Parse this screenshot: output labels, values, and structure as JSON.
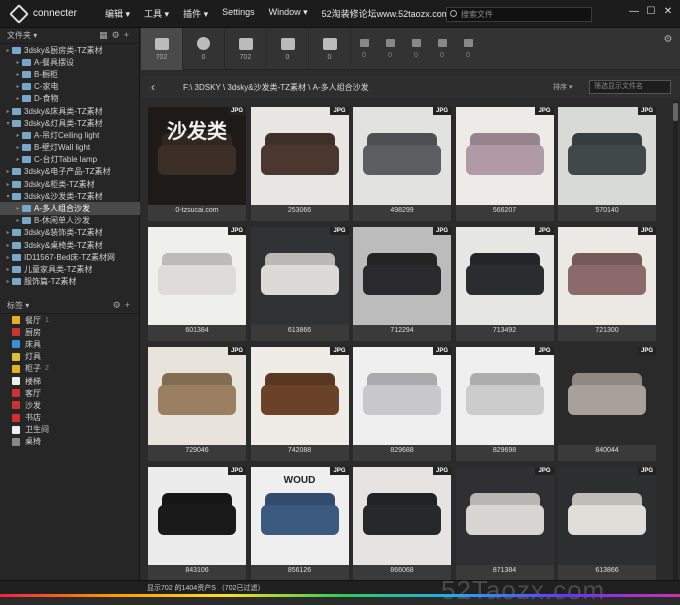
{
  "app": {
    "name": "connecter"
  },
  "menu": [
    "编辑 ▾",
    "工具 ▾",
    "插件 ▾",
    "Settings",
    "Window ▾",
    "52淘装修论坛www.52taozx.com ▾"
  ],
  "search": {
    "placeholder": "搜索文件"
  },
  "left": {
    "folders_title": "文件夹 ▾",
    "tags_title": "标签 ▾",
    "tree": [
      {
        "label": "3dsky&厨房类-TZ素材",
        "level": 0,
        "arrow": "▸",
        "sel": false
      },
      {
        "label": "A-餐具摆设",
        "level": 1,
        "arrow": "▸",
        "sel": false
      },
      {
        "label": "B-橱柜",
        "level": 1,
        "arrow": "▸",
        "sel": false
      },
      {
        "label": "C-家电",
        "level": 1,
        "arrow": "▸",
        "sel": false
      },
      {
        "label": "D-食物",
        "level": 1,
        "arrow": "▸",
        "sel": false
      },
      {
        "label": "3dsky&床具类-TZ素材",
        "level": 0,
        "arrow": "▸",
        "sel": false
      },
      {
        "label": "3dsky&灯具类-TZ素材",
        "level": 0,
        "arrow": "▾",
        "sel": false
      },
      {
        "label": "A-吊灯Ceiling light",
        "level": 1,
        "arrow": "▸",
        "sel": false
      },
      {
        "label": "B-壁灯Wall light",
        "level": 1,
        "arrow": "▸",
        "sel": false
      },
      {
        "label": "C-台灯Table lamp",
        "level": 1,
        "arrow": "▸",
        "sel": false
      },
      {
        "label": "3dsky&电子产品-TZ素材",
        "level": 0,
        "arrow": "▸",
        "sel": false
      },
      {
        "label": "3dsky&柜类-TZ素材",
        "level": 0,
        "arrow": "▸",
        "sel": false
      },
      {
        "label": "3dsky&沙发类-TZ素材",
        "level": 0,
        "arrow": "▾",
        "sel": false
      },
      {
        "label": "A-多人组合沙发",
        "level": 1,
        "arrow": "▸",
        "sel": true
      },
      {
        "label": "B-休闲单人沙发",
        "level": 1,
        "arrow": "▸",
        "sel": false
      },
      {
        "label": "3dsky&装饰类-TZ素材",
        "level": 0,
        "arrow": "▸",
        "sel": false
      },
      {
        "label": "3dsky&桌椅类-TZ素材",
        "level": 0,
        "arrow": "▸",
        "sel": false
      },
      {
        "label": "ID11567-Bed床-TZ素材网",
        "level": 0,
        "arrow": "▸",
        "sel": false
      },
      {
        "label": "儿童家具类-TZ素材",
        "level": 0,
        "arrow": "▸",
        "sel": false
      },
      {
        "label": "服饰篇-TZ素材",
        "level": 0,
        "arrow": "▸",
        "sel": false
      }
    ],
    "tags": [
      {
        "label": "餐厅",
        "count": "1",
        "color": "#e8b020"
      },
      {
        "label": "厨房",
        "count": "",
        "color": "#d03030"
      },
      {
        "label": "床具",
        "count": "",
        "color": "#3a8ed8"
      },
      {
        "label": "灯具",
        "count": "",
        "color": "#d8c030"
      },
      {
        "label": "柜子",
        "count": "2",
        "color": "#e8b020"
      },
      {
        "label": "楼梯",
        "count": "",
        "color": "#eeeeee"
      },
      {
        "label": "客厅",
        "count": "",
        "color": "#d03030"
      },
      {
        "label": "沙发",
        "count": "",
        "color": "#d03030"
      },
      {
        "label": "书店",
        "count": "",
        "color": "#d03030"
      },
      {
        "label": "卫生间",
        "count": "",
        "color": "#eeeeee"
      },
      {
        "label": "桌椅",
        "count": "",
        "color": "#888888"
      }
    ]
  },
  "toolbar": {
    "big": [
      {
        "count": "702"
      },
      {
        "count": "0"
      },
      {
        "count": "702"
      },
      {
        "count": "0"
      },
      {
        "count": "0"
      }
    ],
    "small": [
      "0",
      "0",
      "0",
      "0",
      "0"
    ]
  },
  "path": {
    "text": "F:\\ 3DSKY \\ 3dsky&沙发类-TZ素材 \\ A-多人组合沙发",
    "sort": "排序 ▾",
    "filter_placeholder": "筛选显示文件名"
  },
  "badge": "JPG",
  "items": [
    {
      "name": "0-tzsucai.com",
      "bg": "#1e1a18",
      "c": "#3a2e26",
      "title": "沙发类"
    },
    {
      "name": "253066",
      "bg": "#e8e6e2",
      "c": "#4a3830",
      "title": ""
    },
    {
      "name": "498299",
      "bg": "#e2e2e0",
      "c": "#5a5e60",
      "title": ""
    },
    {
      "name": "566207",
      "bg": "#ecebe8",
      "c": "#b09aa6",
      "title": ""
    },
    {
      "name": "570140",
      "bg": "#d8dad8",
      "c": "#40484a",
      "title": ""
    },
    {
      "name": "601384",
      "bg": "#efefec",
      "c": "#dedcd8",
      "title": ""
    },
    {
      "name": "613866",
      "bg": "#303234",
      "c": "#dcdad6",
      "title": ""
    },
    {
      "name": "712294",
      "bg": "#bcbcbc",
      "c": "#2a2a2c",
      "title": ""
    },
    {
      "name": "713492",
      "bg": "#e6e6e4",
      "c": "#2a2c30",
      "title": ""
    },
    {
      "name": "721300",
      "bg": "#ece8e4",
      "c": "#8a6a6a",
      "title": ""
    },
    {
      "name": "729046",
      "bg": "#e8e4dc",
      "c": "#9a8060",
      "title": ""
    },
    {
      "name": "742088",
      "bg": "#efece8",
      "c": "#6a4228",
      "title": ""
    },
    {
      "name": "829688",
      "bg": "#efefef",
      "c": "#c8c8cc",
      "title": ""
    },
    {
      "name": "829698",
      "bg": "#efefef",
      "c": "#cccccc",
      "title": ""
    },
    {
      "name": "840044",
      "bg": "#2a2a2a",
      "c": "#a8a09a",
      "title": ""
    },
    {
      "name": "843106",
      "bg": "#ececec",
      "c": "#1a1a1a",
      "title": ""
    },
    {
      "name": "856126",
      "bg": "#efefef",
      "c": "#3c5a80",
      "title": "WOUD"
    },
    {
      "name": "866068",
      "bg": "#e6e4e2",
      "c": "#26282a",
      "title": ""
    },
    {
      "name": "871384",
      "bg": "#303032",
      "c": "#d8d6d2",
      "title": ""
    },
    {
      "name": "613866",
      "bg": "#2c2e30",
      "c": "#e0ded8",
      "title": ""
    }
  ],
  "status": {
    "text": "显示702 的1404资产S （702已过滤）",
    "watermark": "52Taozx.com"
  }
}
